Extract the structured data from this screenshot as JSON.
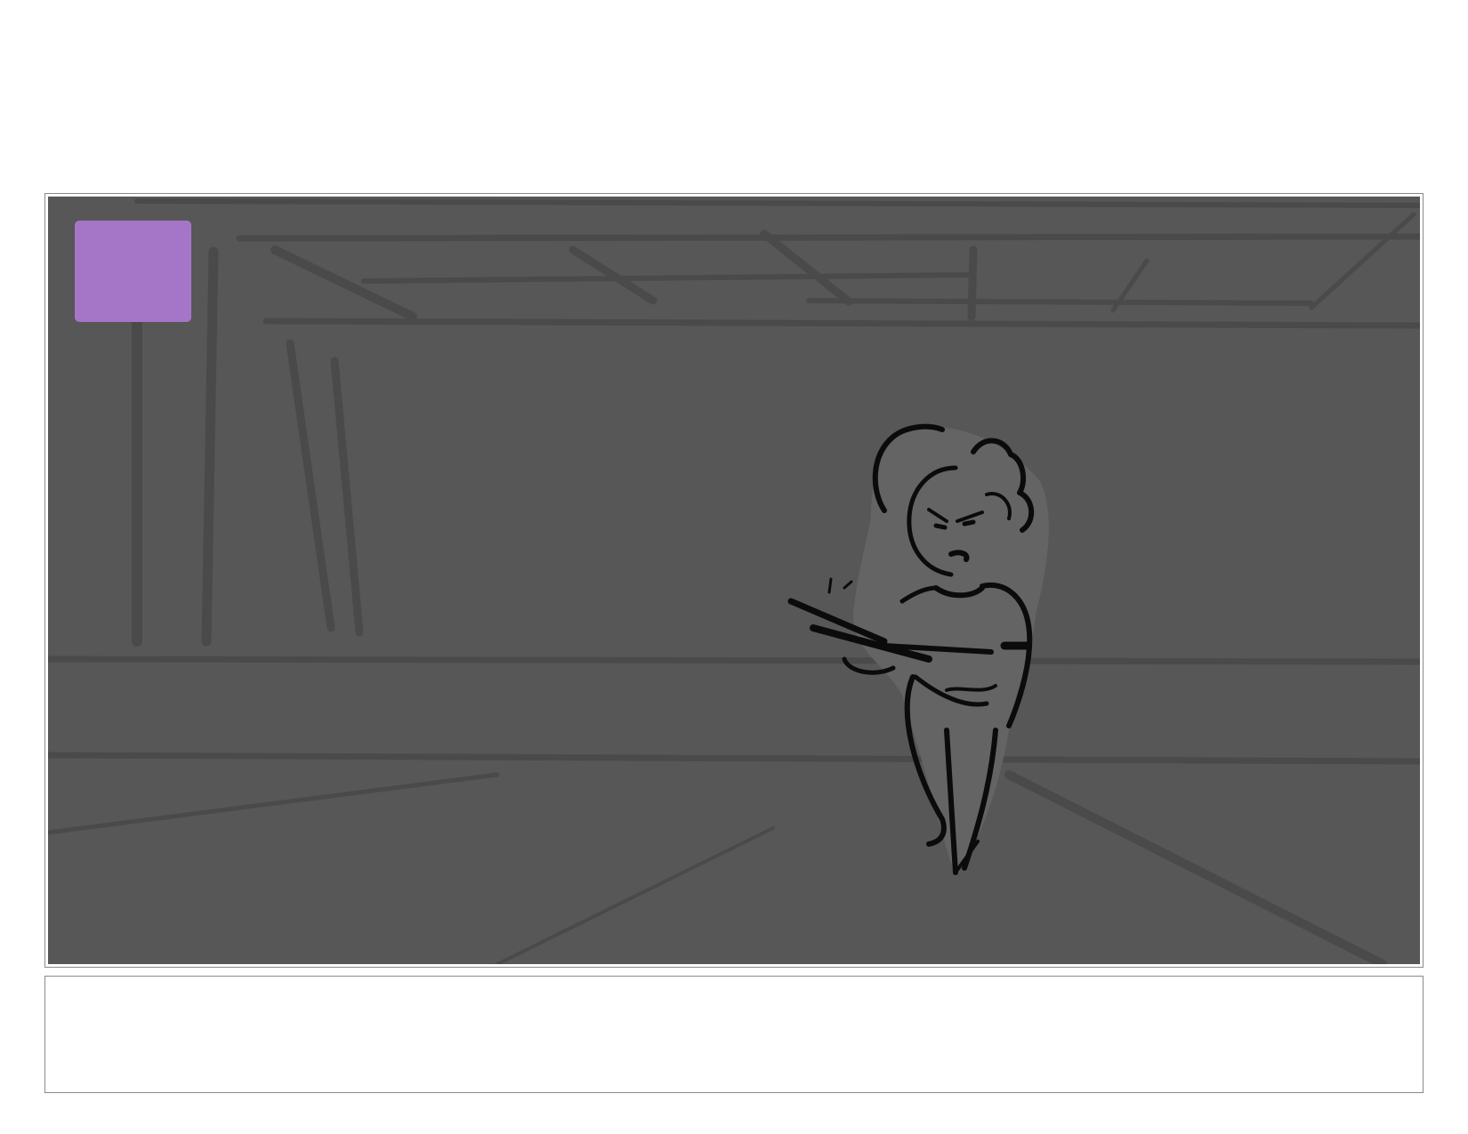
{
  "storyboard": {
    "panel": {
      "background_color": "#575757",
      "sketch_line_color": "#4a4a4a",
      "character_line_color": "#0b0b0b",
      "character_fill_color": "#646464"
    },
    "marker": {
      "color": "#a576c8"
    },
    "caption": {
      "text": ""
    }
  }
}
